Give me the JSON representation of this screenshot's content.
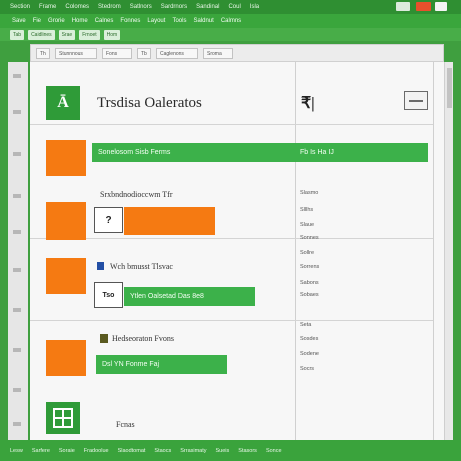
{
  "titlebar": {
    "items": [
      "Section",
      "Frame",
      "Colomes",
      "Stedrom",
      "Satlnors",
      "Sardrnors",
      "Sandinal",
      "Coul",
      "Isla"
    ]
  },
  "ribbon": {
    "items": [
      "Save",
      "Fie",
      "Grorie",
      "Home",
      "Calnes",
      "Fonnes",
      "Layout",
      "Tools",
      "Saldnut",
      "Calmns"
    ]
  },
  "tabstrip": {
    "tabs": [
      "Tab",
      "Caidlines",
      "Srae",
      "Frnoet",
      "Hom"
    ]
  },
  "toolbar": {
    "items": [
      "Th",
      "Stunnnous",
      "Fons",
      "Tb",
      "Caglenons",
      "Sroma"
    ]
  },
  "app": {
    "logo_letter": "Ā",
    "title": "Trsdisa Oaleratos",
    "price_symbol": "₹|"
  },
  "rows": [
    {
      "bar_text": "Sonelosom Sisb Ferms",
      "right_text": "Fb  Is  Ha  IJ"
    },
    {
      "label": "Srxbndnodioccwm  Tfr",
      "box_text": "?",
      "right_lines": [
        "Slasmo",
        "Slllhs",
        "Slaue",
        "Sonnes"
      ]
    },
    {
      "label": "Wch bmusst Tlsvac",
      "box_text": "Tso",
      "bar_text": "Ytlen Oalsetad  Das 8e8",
      "right_lines": [
        "Sollre",
        "Sorrens",
        "Sabons",
        "Sobaes"
      ]
    },
    {
      "label": "Hedseoraton Fvons",
      "bar_text": "Dsl  YN  Fonme  Faj",
      "right_lines": [
        "Seta",
        "Sosdes",
        "Sodene",
        "Socrs"
      ]
    }
  ],
  "footer_label": "Fcnas",
  "statusbar": {
    "items": [
      "Lesw",
      "Sarfere",
      "Soraie",
      "Fradoolue",
      "Slaodtomat",
      "Staocs",
      "Srrasimaty",
      "Sueis",
      "Stasors",
      "Sonce"
    ]
  },
  "colors": {
    "brand_green": "#3cb14a",
    "accent_orange": "#f57a12"
  }
}
